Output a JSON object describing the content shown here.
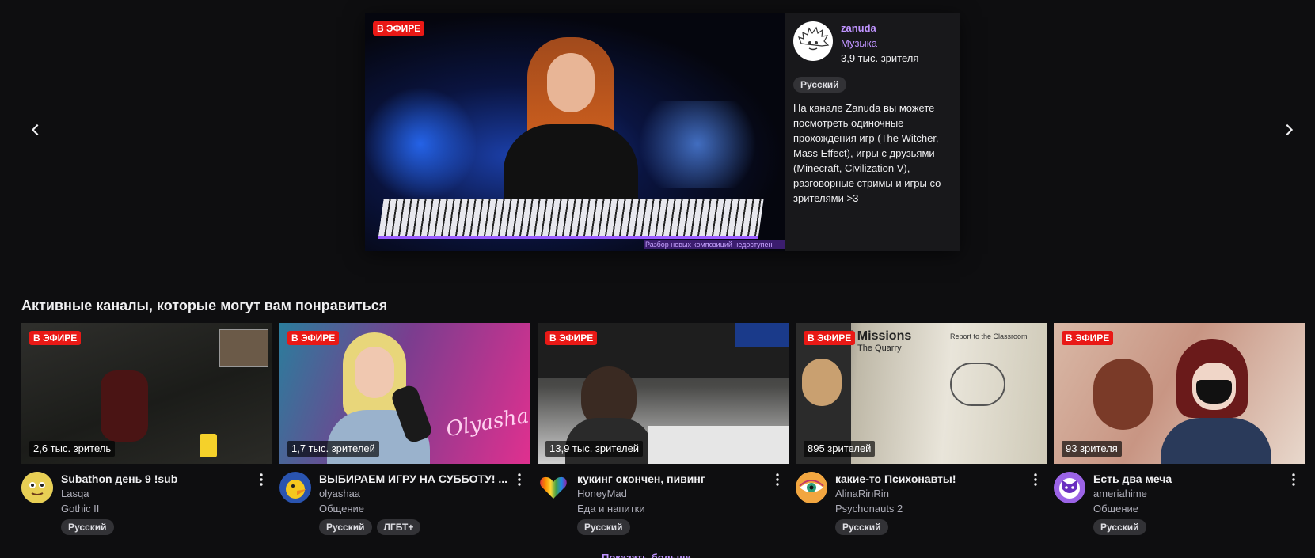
{
  "hero": {
    "live_label": "В ЭФИРЕ",
    "channel": "zanuda",
    "game": "Музыка",
    "viewers": "3,9 тыс. зрителя",
    "tag": "Русский",
    "description": "На канале Zanuda вы можете посмотреть одиночные прохождения игр (The Witcher, Mass Effect), игры с друзьями (Minecraft, Civilization V), разговорные стримы и игры со зрителями >3",
    "video_caption": "Разбор новых композиций недоступен"
  },
  "carousel": {
    "prev_icon": "chevron-left-icon",
    "next_icon": "chevron-right-icon"
  },
  "section": {
    "title": "Активные каналы, которые могут вам понравиться",
    "show_more": "Показать больше"
  },
  "cards": [
    {
      "live_label": "В ЭФИРЕ",
      "viewers": "2,6 тыс. зритель",
      "title": "Subathon день 9 !sub",
      "channel": "Lasqa",
      "game": "Gothic II",
      "tags": [
        "Русский"
      ]
    },
    {
      "live_label": "В ЭФИРЕ",
      "viewers": "1,7 тыс. зрителей",
      "title": "ВЫБИРАЕМ ИГРУ НА СУББОТУ! ...",
      "channel": "olyashaa",
      "game": "Общение",
      "tags": [
        "Русский",
        "ЛГБТ+"
      ]
    },
    {
      "live_label": "В ЭФИРЕ",
      "viewers": "13,9 тыс. зрителей",
      "title": "кукинг окончен, пивинг",
      "channel": "HoneyMad",
      "game": "Еда и напитки",
      "tags": [
        "Русский"
      ]
    },
    {
      "live_label": "В ЭФИРЕ",
      "viewers": "895 зрителей",
      "title": "какие-то Психонавты!",
      "channel": "AlinaRinRin",
      "game": "Psychonauts 2",
      "tags": [
        "Русский"
      ]
    },
    {
      "live_label": "В ЭФИРЕ",
      "viewers": "93 зрителя",
      "title": "Есть два меча",
      "channel": "ameriahime",
      "game": "Общение",
      "tags": [
        "Русский"
      ]
    }
  ],
  "thumb_text": {
    "card2_overlay": "Olyashaa",
    "card4_book_title": "al Missions",
    "card4_book_sub": "The Quarry",
    "card4_page_title": "Report to the Classroom"
  },
  "colors": {
    "accent": "#bf94ff",
    "live": "#e91916",
    "background": "#0e0e10"
  }
}
